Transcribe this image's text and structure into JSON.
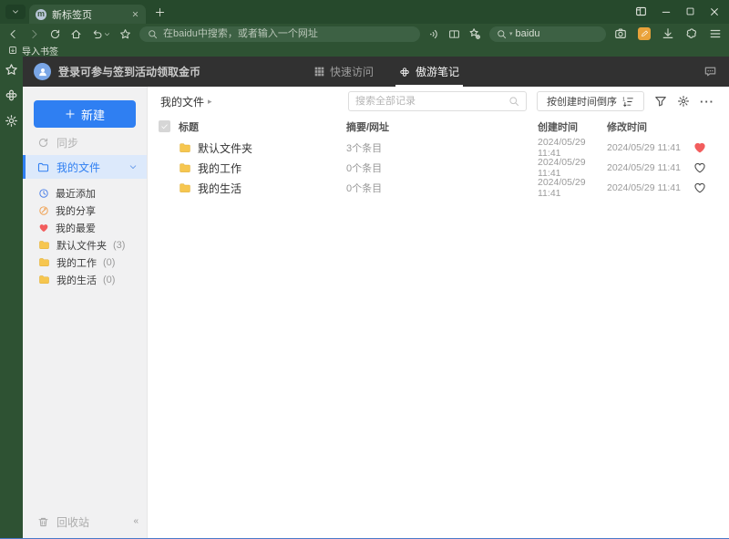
{
  "browser": {
    "tab": {
      "title": "新标签页"
    },
    "address_bar": {
      "placeholder": "在baidu中搜索，或者输入一个网址"
    },
    "search_box": {
      "engine_value": "baidu"
    },
    "bookmarks_bar": {
      "import_label": "导入书签"
    }
  },
  "header": {
    "login_text": "登录可参与签到活动领取金币",
    "tabs": [
      {
        "label": "快速访问",
        "active": false
      },
      {
        "label": "傲游笔记",
        "active": true
      }
    ]
  },
  "sidebar": {
    "new_button": "新建",
    "sync_label": "同步",
    "my_files_label": "我的文件",
    "items": [
      {
        "label": "最近添加",
        "icon": "clock-icon"
      },
      {
        "label": "我的分享",
        "icon": "share-icon"
      },
      {
        "label": "我的最爱",
        "icon": "heart-icon"
      },
      {
        "label": "默认文件夹",
        "count": "(3)",
        "icon": "folder-icon"
      },
      {
        "label": "我的工作",
        "count": "(0)",
        "icon": "folder-icon"
      },
      {
        "label": "我的生活",
        "count": "(0)",
        "icon": "folder-icon"
      }
    ],
    "recycle_bin_label": "回收站",
    "collapse_glyph": "«"
  },
  "content": {
    "breadcrumb": "我的文件",
    "search_placeholder": "搜索全部记录",
    "sort_button_label": "按创建时间倒序",
    "table": {
      "headers": {
        "title": "标题",
        "summary": "摘要/网址",
        "created": "创建时间",
        "modified": "修改时间"
      },
      "rows": [
        {
          "title": "默认文件夹",
          "summary": "3个条目",
          "created": "2024/05/29 11:41",
          "modified": "2024/05/29 11:41",
          "favorite": true
        },
        {
          "title": "我的工作",
          "summary": "0个条目",
          "created": "2024/05/29 11:41",
          "modified": "2024/05/29 11:41",
          "favorite": false
        },
        {
          "title": "我的生活",
          "summary": "0个条目",
          "created": "2024/05/29 11:41",
          "modified": "2024/05/29 11:41",
          "favorite": false
        }
      ]
    }
  },
  "colors": {
    "chrome_green": "#2e5233",
    "tabstrip_green": "#26492c",
    "active_tab_green": "#35583b",
    "field_green": "#3d6144",
    "page_header_dark": "#313131",
    "accent_blue": "#2f7ff2",
    "selected_item_bg": "#dce9fb",
    "folder_yellow": "#f6c64f",
    "heart_red": "#f25d5d",
    "note_orange": "#e9a23b"
  },
  "icons": {
    "tab_favicon": "maxthon-logo (m)",
    "nav": [
      "back-chevron",
      "forward-chevron",
      "refresh",
      "home",
      "undo+caret",
      "star"
    ],
    "address_right": [
      "read-aloud",
      "reader-mode",
      "favorites-manager"
    ],
    "toolbar_right": [
      "screenshot-camera",
      "maxnote-orange",
      "download-arrow",
      "skin-blob",
      "menu-hamburger"
    ],
    "window": [
      "workspace-box",
      "minimize",
      "maximize",
      "close-x"
    ],
    "content_toolbar": [
      "search-magnifier",
      "numbered-sort",
      "filter-funnel",
      "gear",
      "more-dots"
    ]
  }
}
